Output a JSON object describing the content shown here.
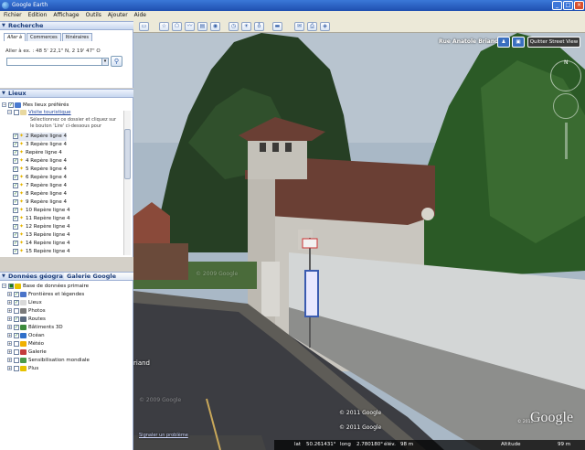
{
  "window": {
    "title": "Google Earth"
  },
  "menu": [
    "Fichier",
    "Edition",
    "Affichage",
    "Outils",
    "Ajouter",
    "Aide"
  ],
  "search": {
    "header": "Recherche",
    "tabs": [
      "Aller à",
      "Commerces",
      "Itinéraires"
    ],
    "label": "Aller à ex. : 48 5' 22,1\" N, 2 19' 47\" O",
    "value": ""
  },
  "places": {
    "header": "Lieux",
    "favorites": "Mes lieux préférés",
    "tour": "Visite touristique",
    "hint_line1": "Sélectionnez ce dossier et cliquez sur",
    "hint_line2": "le bouton 'Lire' ci-dessous pour",
    "items": [
      "2 Repère ligne 4",
      "3 Repère ligne 4",
      "Repère ligne 4",
      "4 Repère ligne 4",
      "5 Repère ligne 4",
      "6 Repère ligne 4",
      "7 Repère ligne 4",
      "8 Repère ligne 4",
      "9 Repère ligne 4",
      "10 Repère ligne 4",
      "11 Repère ligne 4",
      "12 Repère ligne 4",
      "13 Repère ligne 4",
      "14 Repère ligne 4",
      "15 Repère ligne 4"
    ]
  },
  "layers": {
    "tab_primary": "Données géogra",
    "tab_gallery": "Galerie Google Earth »",
    "root": "Base de données primaire",
    "items": [
      {
        "label": "Frontières et légendes",
        "icon": "#4a74c9"
      },
      {
        "label": "Lieux",
        "icon": "#d9d9d9"
      },
      {
        "label": "Photos",
        "icon": "#7a7a7a"
      },
      {
        "label": "Routes",
        "icon": "#5a6a80"
      },
      {
        "label": "Bâtiments 3D",
        "icon": "#3c8a3c"
      },
      {
        "label": "Océan",
        "icon": "#2f6fc9"
      },
      {
        "label": "Météo",
        "icon": "#f0b000"
      },
      {
        "label": "Galerie",
        "icon": "#c43c3c"
      },
      {
        "label": "Sensibilisation mondiale",
        "icon": "#4a9a4a"
      },
      {
        "label": "Plus",
        "icon": "#e6c200"
      }
    ]
  },
  "street_view": {
    "location": "Rue Anatole Briand",
    "exit_label": "Quitter Street View",
    "copyright_1": "© 2011 Google",
    "copyright_2": "© 2011 Google",
    "watermark": "© 2009 Google",
    "side_text": "riand",
    "report": "Signaler un problème",
    "logo": "Google",
    "logo_small": "© 2011"
  },
  "status": {
    "lat_label": "lat",
    "lat": "50.261431°",
    "lon_label": "long",
    "lon": "2.780180°",
    "elev_label": "élév.",
    "elev": "98 m",
    "alt_label": "Altitude",
    "alt": "99 m"
  },
  "colors": {
    "sky": "#aab9c8",
    "tree": "#2c4a2a",
    "wall": "#d0d3d3",
    "road": "#3e3f44"
  }
}
